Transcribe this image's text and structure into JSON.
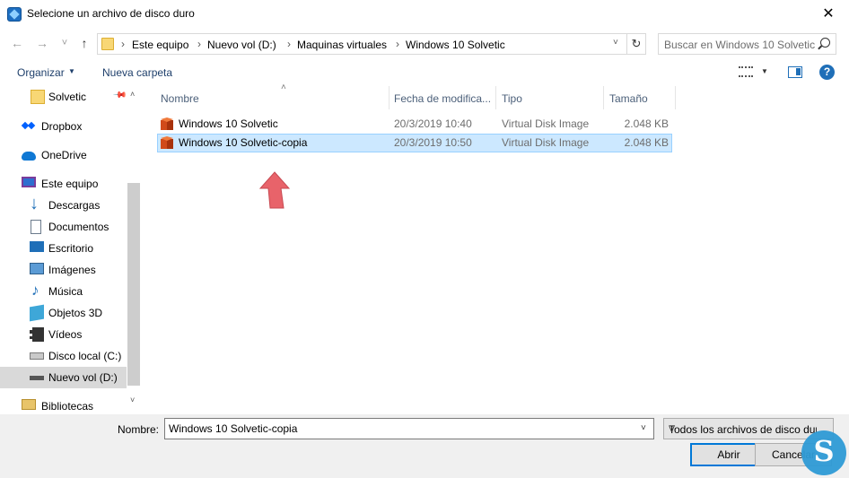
{
  "window": {
    "title": "Selecione un archivo de disco duro",
    "close_glyph": "✕"
  },
  "nav": {
    "back": "←",
    "forward": "→",
    "history": "˅",
    "up": "↑",
    "breadcrumbs": [
      "Este equipo",
      "Nuevo vol (D:)",
      "Maquinas virtuales",
      "Windows 10 Solvetic"
    ],
    "separator": "›",
    "refresh": "↻",
    "search_placeholder": "Buscar en Windows 10 Solvetic"
  },
  "toolbar": {
    "organize": "Organizar",
    "new_folder": "Nueva carpeta",
    "caret": "▼",
    "help": "?"
  },
  "sidebar": {
    "items": [
      {
        "label": "Solvetic",
        "icon": "folder-icon"
      },
      {
        "label": "Dropbox",
        "icon": "dropbox-icon"
      },
      {
        "label": "OneDrive",
        "icon": "onedrive-icon"
      },
      {
        "label": "Este equipo",
        "icon": "computer-icon"
      },
      {
        "label": "Descargas",
        "icon": "downloads-icon"
      },
      {
        "label": "Documentos",
        "icon": "documents-icon"
      },
      {
        "label": "Escritorio",
        "icon": "desktop-icon"
      },
      {
        "label": "Imágenes",
        "icon": "pictures-icon"
      },
      {
        "label": "Música",
        "icon": "music-icon"
      },
      {
        "label": "Objetos 3D",
        "icon": "3d-objects-icon"
      },
      {
        "label": "Vídeos",
        "icon": "videos-icon"
      },
      {
        "label": "Disco local (C:)",
        "icon": "local-disk-icon"
      },
      {
        "label": "Nuevo vol (D:)",
        "icon": "drive-icon"
      },
      {
        "label": "Bibliotecas",
        "icon": "libraries-icon"
      }
    ],
    "selected": "Nuevo vol (D:)"
  },
  "columns": [
    "Nombre",
    "Fecha de modifica...",
    "Tipo",
    "Tamaño"
  ],
  "files": [
    {
      "name": "Windows 10 Solvetic",
      "date": "20/3/2019 10:40",
      "type": "Virtual Disk Image",
      "size": "2.048 KB"
    },
    {
      "name": "Windows 10 Solvetic-copia",
      "date": "20/3/2019 10:50",
      "type": "Virtual Disk Image",
      "size": "2.048 KB"
    }
  ],
  "selected_file": "Windows 10 Solvetic-copia",
  "footer": {
    "name_label": "Nombre:",
    "name_value": "Windows 10 Solvetic-copia",
    "filter": "Todos los archivos de disco duro",
    "open": "Abrir",
    "cancel": "Cancelar"
  },
  "colors": {
    "selection": "#cce8ff",
    "selection_border": "#99d1ff",
    "accent": "#0078d7",
    "arrow": "#e8636a"
  }
}
